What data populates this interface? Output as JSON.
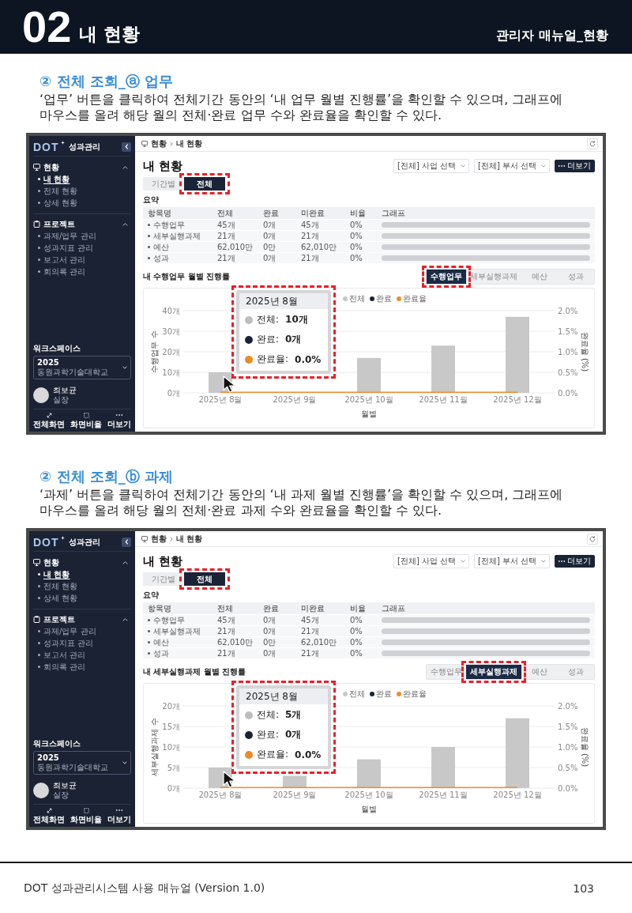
{
  "header": {
    "number": "02",
    "title": "내 현황",
    "subtitle": "관리자 매뉴얼_현황"
  },
  "sections": [
    {
      "heading": "② 전체 조회_ⓐ 업무",
      "description": "‘업무’ 버튼을 클릭하여 전체기간 동안의 ‘내 업무 월별 진행률’을 확인할 수 있으며, 그래프에\n마우스를 올려 해당 월의 전체·완료 업무 수와 완료율을 확인할 수 있다.",
      "screenshot": {
        "sidebar": {
          "logo": "DOT",
          "brand": "성과관리",
          "groups": [
            {
              "label": "현황",
              "expanded": true,
              "items": [
                {
                  "label": "내 현황",
                  "selected": true
                },
                {
                  "label": "전체 현황",
                  "selected": false
                },
                {
                  "label": "상세 현황",
                  "selected": false
                }
              ]
            },
            {
              "label": "프로젝트",
              "expanded": true,
              "items": [
                {
                  "label": "과제/업무 관리",
                  "selected": false
                },
                {
                  "label": "성과지표 관리",
                  "selected": false
                },
                {
                  "label": "보고서 관리",
                  "selected": false
                },
                {
                  "label": "회의록 관리",
                  "selected": false
                }
              ]
            }
          ],
          "workspace": {
            "label": "워크스페이스",
            "year": "2025",
            "org": "동원과학기술대학교"
          },
          "user": {
            "name": "최보균",
            "role": "실장"
          },
          "actions": [
            "전체화면",
            "화면비율",
            "더보기"
          ]
        },
        "breadcrumb": [
          "현황",
          "내 현황"
        ],
        "title": "내 현황",
        "filters": [
          {
            "value": "[전체] 사업 선택"
          },
          {
            "value": "[전체] 부서 선택"
          }
        ],
        "more_button": "더보기",
        "scope_tabs": [
          {
            "label": "기간별",
            "selected": false,
            "highlighted": false
          },
          {
            "label": "전체",
            "selected": true,
            "highlighted": true
          }
        ],
        "summary": {
          "title": "요약",
          "columns": [
            "항목명",
            "전체",
            "완료",
            "미완료",
            "비율",
            "그래프"
          ],
          "rows": [
            {
              "cells": [
                "수행업무",
                "45개",
                "0개",
                "45개",
                "0%"
              ],
              "level": 0
            },
            {
              "cells": [
                "세부실행과제",
                "21개",
                "0개",
                "21개",
                "0%"
              ],
              "level": 0
            },
            {
              "cells": [
                "예산",
                "62,010만",
                "0만",
                "62,010만",
                "0%"
              ],
              "level": 0
            },
            {
              "cells": [
                "성과",
                "21개",
                "0개",
                "21개",
                "0%"
              ],
              "level": 0
            }
          ]
        },
        "chart_panel": {
          "title": "내 수행업무 월별 진행률",
          "tabs": [
            {
              "label": "수행업무",
              "selected": true,
              "highlighted": true
            },
            {
              "label": "세부실행과제",
              "selected": false,
              "highlighted": false
            },
            {
              "label": "예산",
              "selected": false,
              "highlighted": false
            },
            {
              "label": "성과",
              "selected": false,
              "highlighted": false
            }
          ],
          "chart_data": {
            "type": "bar",
            "xlabel": "월별",
            "ylabel": "수행업무 수",
            "categories": [
              "2025년 8월",
              "2025년 9월",
              "2025년 10월",
              "2025년 11월",
              "2025년 12월"
            ],
            "series": [
              {
                "name": "전체",
                "color": "#c8c8c8",
                "values": [
                  10,
                  null,
                  17,
                  23,
                  37
                ]
              },
              {
                "name": "완료",
                "color": "#1b2436",
                "values": [
                  0,
                  0,
                  0,
                  0,
                  0
                ]
              },
              {
                "name": "완료율",
                "type": "line",
                "color": "#f28c28",
                "values": [
                  0,
                  0,
                  0,
                  0,
                  0
                ]
              }
            ],
            "ylim": [
              0,
              40
            ],
            "yticks": [
              {
                "value": 0,
                "label": "0개"
              },
              {
                "value": 10,
                "label": "10개"
              },
              {
                "value": 20,
                "label": "20개"
              },
              {
                "value": 30,
                "label": "30개"
              },
              {
                "value": 40,
                "label": "40개"
              }
            ],
            "grid": true,
            "legend": "top",
            "y2label": "완료율 (%)",
            "y2lim": [
              0,
              2
            ],
            "y2ticks": [
              {
                "value": 0,
                "label": "0.0%"
              },
              {
                "value": 0.5,
                "label": "0.5%"
              },
              {
                "value": 1,
                "label": "1.0%"
              },
              {
                "value": 1.5,
                "label": "1.5%"
              },
              {
                "value": 2,
                "label": "2.0%"
              }
            ]
          },
          "tooltip": {
            "title": "2025년 8월",
            "highlighted": true,
            "items": [
              {
                "label": "전체:",
                "value": "10개",
                "color": "#bdbdbd"
              },
              {
                "label": "완료:",
                "value": "0개",
                "color": "#1b2436"
              },
              {
                "label": "완료율:",
                "value": "0.0%",
                "color": "#f08a24"
              }
            ]
          }
        }
      }
    },
    {
      "heading": "② 전체 조회_ⓑ 과제",
      "description": "‘과제’ 버튼을 클릭하여 전체기간 동안의 ‘내 과제 월별 진행률’을 확인할 수 있으며, 그래프에\n마우스를 올려 해당 월의 전체·완료 과제 수와 완료율을 확인할 수 있다.",
      "screenshot": {
        "sidebar": {
          "logo": "DOT",
          "brand": "성과관리",
          "groups": [
            {
              "label": "현황",
              "expanded": true,
              "items": [
                {
                  "label": "내 현황",
                  "selected": true
                },
                {
                  "label": "전체 현황",
                  "selected": false
                },
                {
                  "label": "상세 현황",
                  "selected": false
                }
              ]
            },
            {
              "label": "프로젝트",
              "expanded": true,
              "items": [
                {
                  "label": "과제/업무 관리",
                  "selected": false
                },
                {
                  "label": "성과지표 관리",
                  "selected": false
                },
                {
                  "label": "보고서 관리",
                  "selected": false
                },
                {
                  "label": "회의록 관리",
                  "selected": false
                }
              ]
            }
          ],
          "workspace": {
            "label": "워크스페이스",
            "year": "2025",
            "org": "동원과학기술대학교"
          },
          "user": {
            "name": "최보균",
            "role": "실장"
          },
          "actions": [
            "전체화면",
            "화면비율",
            "더보기"
          ]
        },
        "breadcrumb": [
          "현황",
          "내 현황"
        ],
        "title": "내 현황",
        "filters": [
          {
            "value": "[전체] 사업 선택"
          },
          {
            "value": "[전체] 부서 선택"
          }
        ],
        "more_button": "더보기",
        "scope_tabs": [
          {
            "label": "기간별",
            "selected": false,
            "highlighted": false
          },
          {
            "label": "전체",
            "selected": true,
            "highlighted": true
          }
        ],
        "summary": {
          "title": "요약",
          "columns": [
            "항목명",
            "전체",
            "완료",
            "미완료",
            "비율",
            "그래프"
          ],
          "rows": [
            {
              "cells": [
                "수행업무",
                "45개",
                "0개",
                "45개",
                "0%"
              ],
              "level": 0
            },
            {
              "cells": [
                "세부실행과제",
                "21개",
                "0개",
                "21개",
                "0%"
              ],
              "level": 0
            },
            {
              "cells": [
                "예산",
                "62,010만",
                "0만",
                "62,010만",
                "0%"
              ],
              "level": 0
            },
            {
              "cells": [
                "성과",
                "21개",
                "0개",
                "21개",
                "0%"
              ],
              "level": 0
            }
          ]
        },
        "chart_panel": {
          "title": "내 세부실행과제 월별 진행률",
          "tabs": [
            {
              "label": "수행업무",
              "selected": false,
              "highlighted": false
            },
            {
              "label": "세부실행과제",
              "selected": true,
              "highlighted": true
            },
            {
              "label": "예산",
              "selected": false,
              "highlighted": false
            },
            {
              "label": "성과",
              "selected": false,
              "highlighted": false
            }
          ],
          "chart_data": {
            "type": "bar",
            "xlabel": "월별",
            "ylabel": "세부실행과제 수",
            "categories": [
              "2025년 8월",
              "2025년 9월",
              "2025년 10월",
              "2025년 11월",
              "2025년 12월"
            ],
            "series": [
              {
                "name": "전체",
                "color": "#c8c8c8",
                "values": [
                  5,
                  3,
                  7,
                  10,
                  17
                ]
              },
              {
                "name": "완료",
                "color": "#1b2436",
                "values": [
                  0,
                  0,
                  0,
                  0,
                  0
                ]
              },
              {
                "name": "완료율",
                "type": "line",
                "color": "#f28c28",
                "values": [
                  0,
                  0,
                  0,
                  0,
                  0
                ]
              }
            ],
            "ylim": [
              0,
              20
            ],
            "yticks": [
              {
                "value": 0,
                "label": "0개"
              },
              {
                "value": 5,
                "label": "5개"
              },
              {
                "value": 10,
                "label": "10개"
              },
              {
                "value": 15,
                "label": "15개"
              },
              {
                "value": 20,
                "label": "20개"
              }
            ],
            "grid": true,
            "legend": "top",
            "y2label": "완료율 (%)",
            "y2lim": [
              0,
              2
            ],
            "y2ticks": [
              {
                "value": 0,
                "label": "0.0%"
              },
              {
                "value": 0.5,
                "label": "0.5%"
              },
              {
                "value": 1,
                "label": "1.0%"
              },
              {
                "value": 1.5,
                "label": "1.5%"
              },
              {
                "value": 2,
                "label": "2.0%"
              }
            ]
          },
          "tooltip": {
            "title": "2025년 8월",
            "highlighted": true,
            "items": [
              {
                "label": "전체:",
                "value": "5개",
                "color": "#bdbdbd"
              },
              {
                "label": "완료:",
                "value": "0개",
                "color": "#1b2436"
              },
              {
                "label": "완료율:",
                "value": "0.0%",
                "color": "#f08a24"
              }
            ]
          }
        }
      }
    }
  ],
  "footer": {
    "text": "DOT 성과관리시스템 사용 매뉴얼 (Version 1.0)",
    "page": "103"
  }
}
